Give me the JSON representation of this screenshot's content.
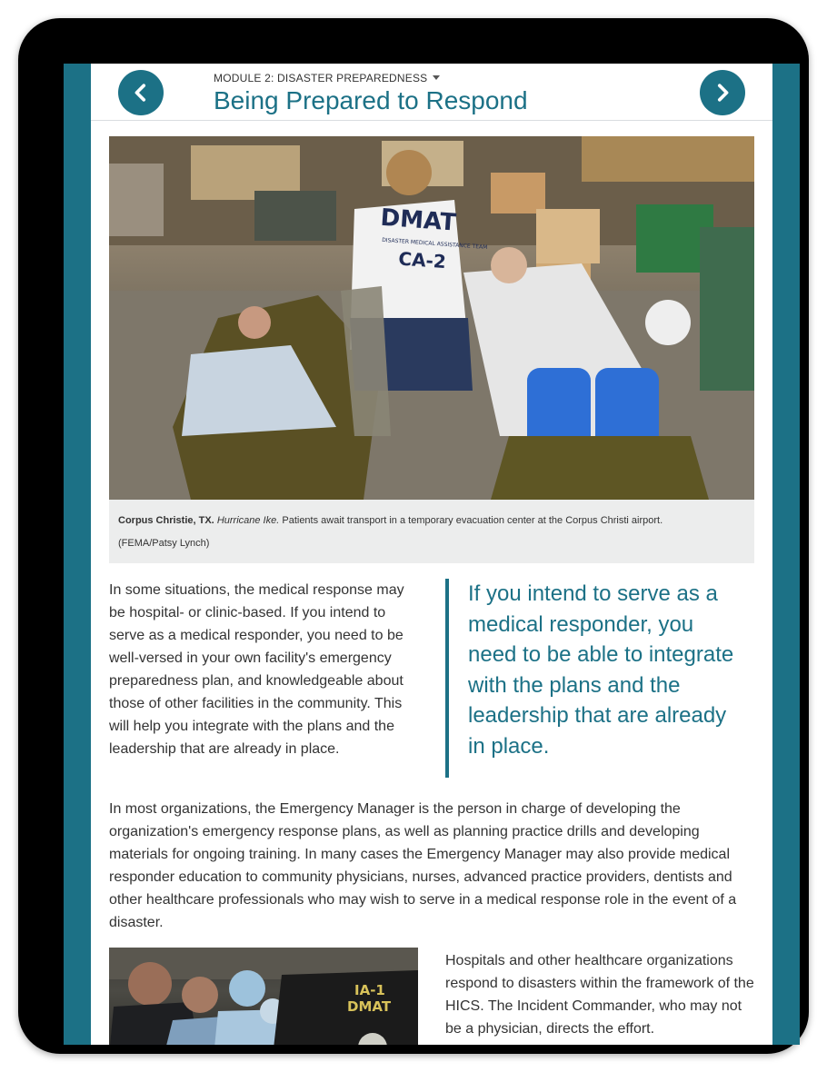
{
  "header": {
    "module_label": "MODULE 2: DISASTER PREPAREDNESS",
    "title": "Being Prepared to Respond",
    "prev_icon": "chevron-left-icon",
    "next_icon": "chevron-right-icon"
  },
  "figure": {
    "image": "photo-dmat-evacuation-center",
    "vest_text": "DMAT",
    "vest_subtext": "DISASTER MEDICAL ASSISTANCE TEAM",
    "vest_id": "CA-2",
    "caption_location": "Corpus Christie, TX.",
    "caption_event": "Hurricane Ike.",
    "caption_text": "Patients await transport in a temporary evacuation center at the Corpus Christi airport.",
    "caption_credit": "(FEMA/Patsy Lynch)"
  },
  "body": {
    "paragraph1": "In some situations, the medical response may be hospital- or clinic-based. If you intend to serve as a medical responder, you need to be well-versed in your own facility's emergency preparedness plan, and knowledgeable about those of other facilities in the community. This will help you integrate with the plans and the leadership that are already in place.",
    "pull_quote": "If you intend to serve as a medical responder, you need to be able to integrate with the plans and the leadership that are already in place.",
    "paragraph2": "In most organizations, the Emergency Manager is the person in charge of developing the organization's emergency response plans, as well as planning practice drills and developing materials for ongoing training. In many cases the Emergency Manager may also provide medical responder education to community physicians, nurses, advanced practice providers, dentists and other healthcare professionals who may wish to serve in a medical response role in the event of a disaster.",
    "paragraph3": "Hospitals and other healthcare organizations respond to disasters within the framework of the HICS. The Incident Commander, who may not be a physician, directs the effort.",
    "image2": "photo-dmat-surgery-team",
    "image2_text_line1": "IA-1",
    "image2_text_line2": "DMAT"
  },
  "colors": {
    "accent": "#1c7186",
    "text": "#333333",
    "caption_bg": "#eceded"
  }
}
